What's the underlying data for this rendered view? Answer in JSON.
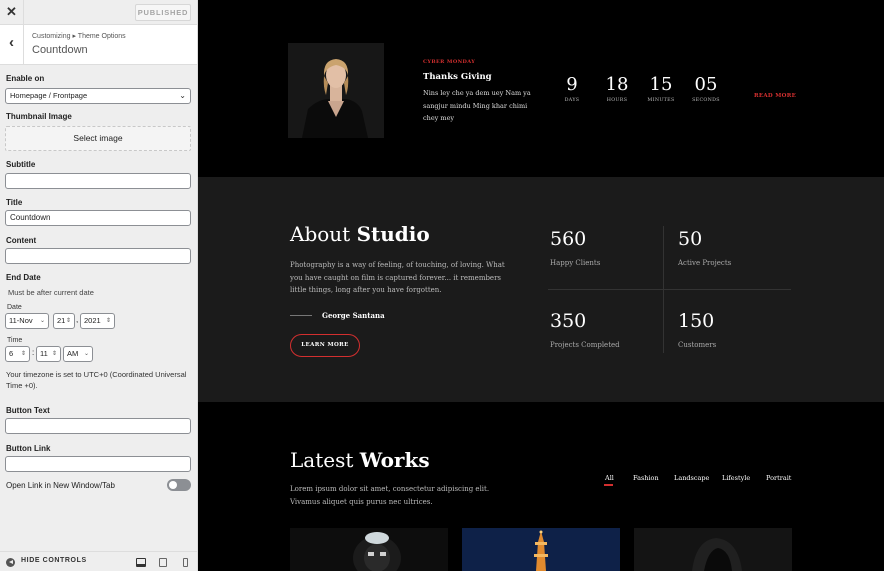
{
  "sidebar": {
    "close_glyph": "✕",
    "published_label": "PUBLISHED",
    "back_glyph": "‹",
    "breadcrumb": "Customizing ▸ Theme Options",
    "section_title": "Countdown",
    "enable_on": {
      "label": "Enable on",
      "value": "Homepage / Frontpage"
    },
    "thumbnail": {
      "label": "Thumbnail Image",
      "button": "Select image"
    },
    "subtitle": {
      "label": "Subtitle",
      "value": ""
    },
    "title": {
      "label": "Title",
      "value": "Countdown"
    },
    "content": {
      "label": "Content",
      "value": ""
    },
    "end_date": {
      "label": "End Date",
      "description": "Must be after current date",
      "date_label": "Date",
      "month": "11-Nov",
      "day": "21",
      "year": "2021",
      "time_label": "Time",
      "hour": "6",
      "minute": "11",
      "ampm": "AM",
      "timezone_note": "Your timezone is set to UTC+0 (Coordinated Universal Time +0)."
    },
    "button_text": {
      "label": "Button Text",
      "value": ""
    },
    "button_link": {
      "label": "Button Link",
      "value": ""
    },
    "new_window": {
      "label": "Open Link in New Window/Tab",
      "enabled": false
    },
    "footer": {
      "hide_controls": "HIDE CONTROLS"
    },
    "icons": [
      "close-icon",
      "back-icon",
      "chevron-down-icon",
      "hide-controls-icon",
      "desktop-icon",
      "tablet-icon",
      "mobile-icon"
    ]
  },
  "preview": {
    "countdown": {
      "kicker": "CYBER MONDAY",
      "title": "Thanks Giving",
      "text": "Nins ley che ya dem uey Nam ya sangjur mindu Ming khar chimi chey mey",
      "units": [
        {
          "num": "9",
          "label": "DAYS"
        },
        {
          "num": "18",
          "label": "HOURS"
        },
        {
          "num": "15",
          "label": "MINUTES"
        },
        {
          "num": "05",
          "label": "SECONDS"
        }
      ],
      "read_more": "READ MORE"
    },
    "about": {
      "title_light": "About",
      "title_bold": "Studio",
      "text": "Photography is a way of feeling, of touching, of loving. What you have caught on film is captured forever... it remembers little things, long after you have forgotten.",
      "author": "George Santana",
      "button": "LEARN MORE",
      "stats": [
        {
          "num": "560",
          "label": "Happy Clients"
        },
        {
          "num": "50",
          "label": "Active Projects"
        },
        {
          "num": "350",
          "label": "Projects Completed"
        },
        {
          "num": "150",
          "label": "Customers"
        }
      ]
    },
    "works": {
      "title_light": "Latest",
      "title_bold": "Works",
      "text": "Lorem ipsum dolor sit amet, consectetur adipiscing elit. Vivamus aliquet quis purus nec ultrices.",
      "filters": [
        "All",
        "Fashion",
        "Landscape",
        "Lifestyle",
        "Portrait"
      ],
      "active_filter": "All"
    },
    "accent_color": "#d32f2f"
  }
}
